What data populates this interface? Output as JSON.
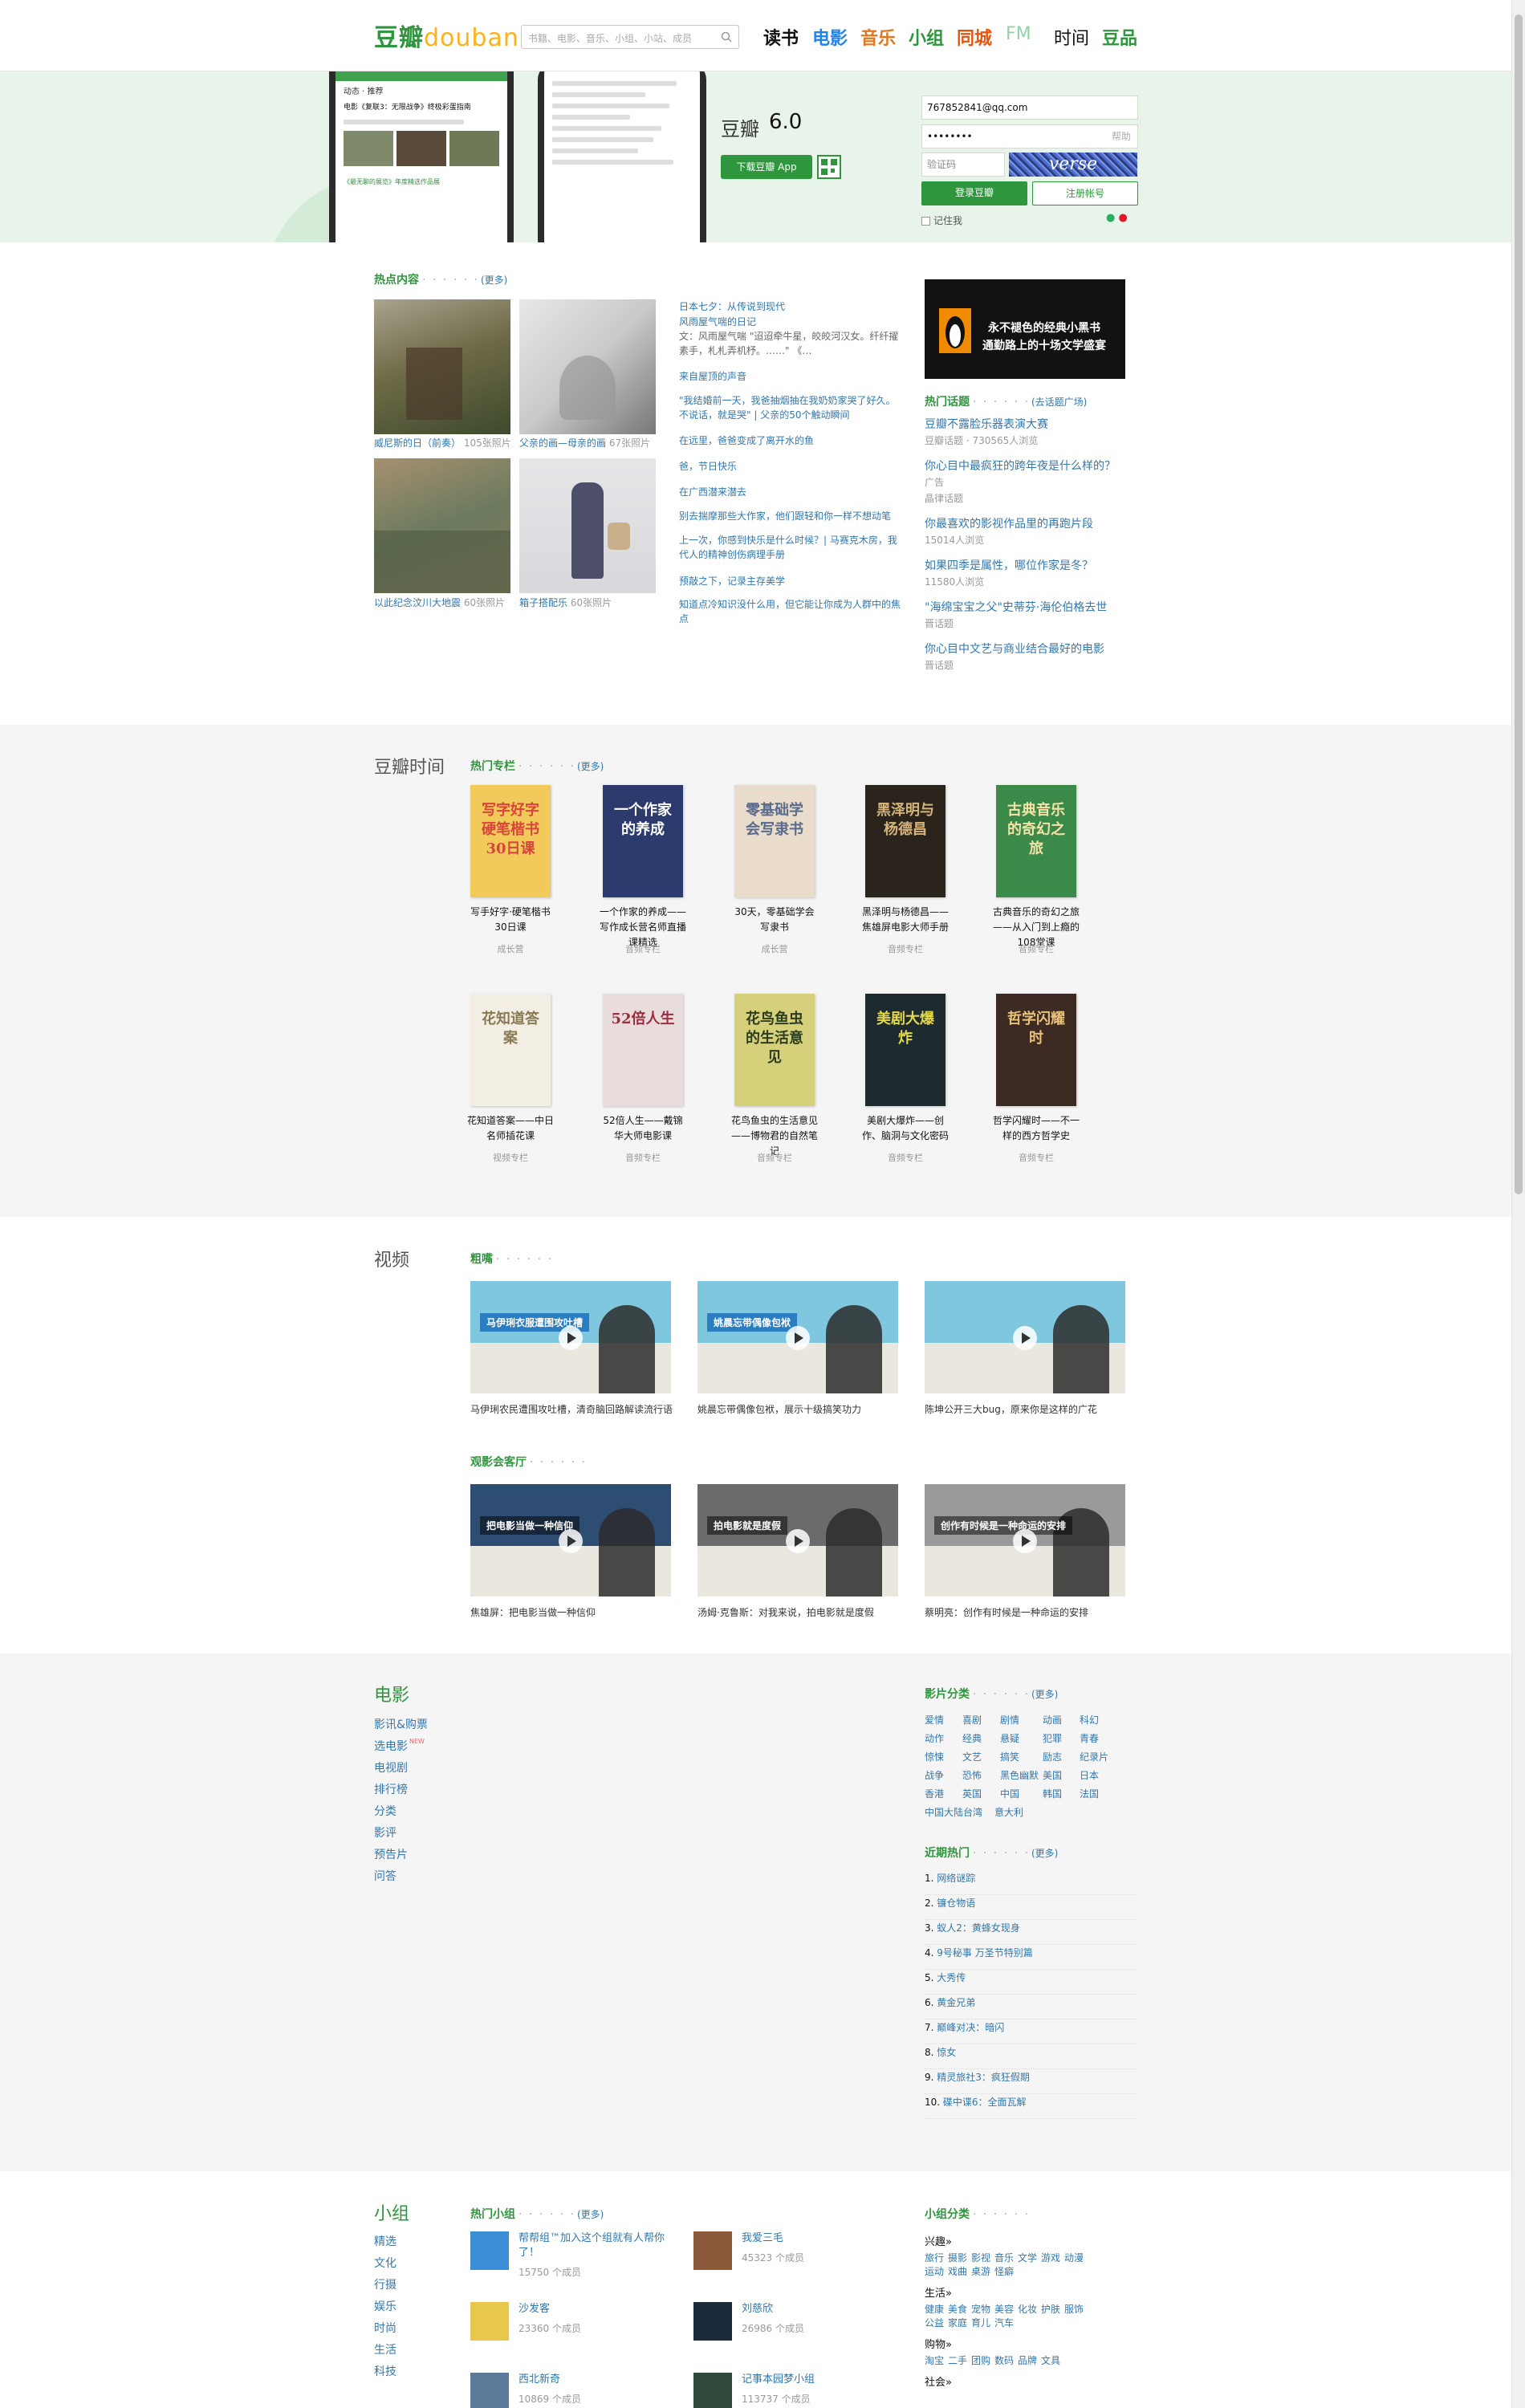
{
  "nav": {
    "logo_cn": "豆瓣",
    "logo_en": "douban",
    "search_placeholder": "书籍、电影、音乐、小组、小站、成员",
    "items": [
      "读书",
      "电影",
      "音乐",
      "小组",
      "同城",
      "FM",
      "时间",
      "豆品"
    ],
    "colors": [
      "#111111",
      "#2384e6",
      "#e3771f",
      "#2e963d",
      "#e6550d",
      "#93d1a8",
      "#111111",
      "#2e963d"
    ]
  },
  "hero": {
    "app_name": "豆瓣",
    "app_version": "6.0",
    "download_label": "下载豆瓣 App",
    "login": {
      "email_value": "767852841@qq.com",
      "password_value": "••••••••",
      "password_help": "帮助",
      "captcha_placeholder": "验证码",
      "captcha_text": "verse",
      "login_label": "登录豆瓣",
      "register_label": "注册帐号",
      "remember_label": "记住我"
    },
    "phone_texts": [
      "动态",
      "推荐",
      "电影《复联3：无限战争》终极彩蛋指南",
      "《最无聊的展览》年度精选作品展"
    ]
  },
  "hot": {
    "heading": "热点内容",
    "more": "(更多)",
    "photos": [
      {
        "title": "威尼斯的日（前奏）",
        "count": "105张照片",
        "colors": [
          "#6f6a48",
          "#a8a48e",
          "#3d4a2c"
        ]
      },
      {
        "title": "父亲的画—母亲的画",
        "count": "67张照片",
        "colors": [
          "#c9c9c9",
          "#777777",
          "#e8e8e8"
        ]
      },
      {
        "title": "以此纪念汶川大地震",
        "count": "60张照片",
        "colors": [
          "#6c7a5e",
          "#8a7a5c",
          "#a69070"
        ]
      },
      {
        "title": "箱子搭配乐",
        "count": "60张照片",
        "colors": [
          "#e6e6e9",
          "#4d4f6a",
          "#c9b08a"
        ]
      }
    ],
    "links": [
      {
        "text": "日本七夕：从传说到现代",
        "type": "link"
      },
      {
        "text": "风雨屋气喘的日记",
        "type": "link"
      },
      {
        "text": "文：风雨屋气喘 \"迢迢牵牛星，皎皎河汉女。纤纤擢素手，札札弄机杼。……\" 《…",
        "type": "sub"
      },
      {
        "text": "来自屋顶的声音",
        "type": "link"
      },
      {
        "text": "\"我结婚前一天，我爸抽烟抽在我奶奶家哭了好久。不说话，就是哭\" | 父亲的50个触动瞬间",
        "type": "link"
      },
      {
        "text": "在远里，爸爸变成了离开水的鱼",
        "type": "link"
      },
      {
        "text": "爸，节日快乐",
        "type": "link"
      },
      {
        "text": "在广西潜来潜去",
        "type": "link"
      },
      {
        "text": "别去揣摩那些大作家，他们跟轻和你一样不想动笔",
        "type": "link"
      },
      {
        "text": "上一次，你感到快乐是什么时候？| 马赛克木房，我代人的精神创伤病理手册",
        "type": "link"
      },
      {
        "text": "预敲之下，记录主存美学",
        "type": "link"
      },
      {
        "text": "知道点冷知识没什么用，但它能让你成为人群中的焦点",
        "type": "link"
      }
    ],
    "ad": {
      "line1": "永不褪色的经典小黑书",
      "line2": "通勤路上的十场文学盛宴"
    },
    "topics_heading": "热门话题",
    "topics_more": "(去话题广场)",
    "topics": [
      {
        "title": "豆瓣不露脸乐器表演大赛",
        "sub": "豆瓣话题 · 730565人浏览"
      },
      {
        "title": "你心目中最疯狂的跨年夜是什么样的？",
        "sub": "广告"
      },
      {
        "title": "",
        "sub": "晶律话题"
      },
      {
        "title": "你最喜欢的影视作品里的再跑片段",
        "sub": "15014人浏览"
      },
      {
        "title": "如果四季是属性，哪位作家是冬？",
        "sub": "11580人浏览"
      },
      {
        "title": "\"海绵宝宝之父\"史蒂芬·海伦伯格去世",
        "sub": "晋话题"
      },
      {
        "title": "你心目中文艺与商业结合最好的电影",
        "sub": "晋话题"
      }
    ]
  },
  "time": {
    "section": "豆瓣时间",
    "heading": "热门专栏",
    "more": "(更多)",
    "books": [
      {
        "cover": "写字好字 硬笔楷书 30日课",
        "title": "写手好字·硬笔楷书30日课",
        "sub": "成长营",
        "bg": "#f2c95b",
        "fg": "#d9453b"
      },
      {
        "cover": "一个作家的养成",
        "title": "一个作家的养成——写作成长营名师直播课精选",
        "sub": "音频专栏",
        "bg": "#2d3a6e",
        "fg": "#ffffff"
      },
      {
        "cover": "零基础学会写隶书",
        "title": "30天，零基础学会写隶书",
        "sub": "成长营",
        "bg": "#e9dccb",
        "fg": "#5a6b8c"
      },
      {
        "cover": "黑泽明与杨德昌",
        "title": "黑泽明与杨德昌——焦雄屏电影大师手册",
        "sub": "音频专栏",
        "bg": "#2a241c",
        "fg": "#d6b47a"
      },
      {
        "cover": "古典音乐的奇幻之旅",
        "title": "古典音乐的奇幻之旅——从入门到上瘾的108堂课",
        "sub": "音频专栏",
        "bg": "#3c8a4a",
        "fg": "#f3e3a6"
      },
      {
        "cover": "花知道答案",
        "title": "花知道答案——中日名师插花课",
        "sub": "视频专栏",
        "bg": "#f3eee4",
        "fg": "#8a7a54"
      },
      {
        "cover": "52倍人生",
        "title": "52倍人生——戴锦华大师电影课",
        "sub": "音频专栏",
        "bg": "#e8dcdc",
        "fg": "#9c2f3f"
      },
      {
        "cover": "花鸟鱼虫的生活意见",
        "title": "花鸟鱼虫的生活意见——博物君的自然笔记",
        "sub": "音频专栏",
        "bg": "#d7d07a",
        "fg": "#2c3e1f"
      },
      {
        "cover": "美剧大爆炸",
        "title": "美剧大爆炸——创作、脑洞与文化密码",
        "sub": "音频专栏",
        "bg": "#1d2a2e",
        "fg": "#e4d94a"
      },
      {
        "cover": "哲学闪耀时",
        "title": "哲学闪耀时——不一样的西方哲学史",
        "sub": "音频专栏",
        "bg": "#3d2a22",
        "fg": "#e8c27a"
      }
    ]
  },
  "video": {
    "section": "视频",
    "heading1": "粗嘴",
    "heading2": "观影会客厅",
    "row1": [
      {
        "caption": "马伊琍农民遭围攻吐槽，清奇脑回路解读流行语",
        "overlay": "马伊琍衣服遭围攻吐槽",
        "bg": "#7fc6df",
        "band": "#2b7dc1"
      },
      {
        "caption": "姚晨忘带偶像包袱，展示十级搞笑功力",
        "overlay": "姚晨忘带偶像包袱",
        "bg": "#7fc6df",
        "band": "#2b7dc1"
      },
      {
        "caption": "陈坤公开三大bug，原来你是这样的广花",
        "overlay": "",
        "bg": "#7fc6df",
        "band": "#2b7dc1"
      }
    ],
    "row2": [
      {
        "caption": "焦雄屏：把电影当做一种信仰",
        "overlay": "把电影当做一种信仰",
        "bg": "#2e4d73",
        "band": ""
      },
      {
        "caption": "汤姆·克鲁斯：对我来说，拍电影就是度假",
        "overlay": "拍电影就是度假",
        "bg": "#6b6b6b",
        "band": ""
      },
      {
        "caption": "蔡明亮：创作有时候是一种命运的安排",
        "overlay": "创作有时候是一种命运的安排",
        "bg": "#9a9a9a",
        "band": ""
      }
    ]
  },
  "movie": {
    "section": "电影",
    "nav": [
      "影讯&购票",
      "选电影",
      "电视剧",
      "排行榜",
      "分类",
      "影评",
      "预告片",
      "问答"
    ],
    "new_badge": "NEW",
    "genre_heading": "影片分类",
    "genre_more": "(更多)",
    "genres": [
      [
        "爱情",
        "喜剧",
        "剧情",
        "动画",
        "科幻"
      ],
      [
        "动作",
        "经典",
        "悬疑",
        "犯罪",
        "青春"
      ],
      [
        "惊悚",
        "文艺",
        "搞笑",
        "励志",
        "纪录片"
      ],
      [
        "战争",
        "恐怖",
        "黑色幽默",
        "美国",
        "日本"
      ],
      [
        "香港",
        "英国",
        "中国",
        "韩国",
        "法国"
      ],
      [
        "中国大陆台湾",
        "意大利"
      ]
    ],
    "recent_heading": "近期热门",
    "recent_more": "(更多)",
    "recent": [
      "网络谜踪",
      "镰仓物语",
      "蚁人2：黄蜂女现身",
      "9号秘事 万圣节特别篇",
      "大秀传",
      "黄金兄弟",
      "巅峰对决：暗闪",
      "惊女",
      "精灵旅社3：疯狂假期",
      "碟中谍6：全面瓦解"
    ]
  },
  "group": {
    "section": "小组",
    "nav": [
      "精选",
      "文化",
      "行摄",
      "娱乐",
      "时尚",
      "生活",
      "科技"
    ],
    "heading": "热门小组",
    "more": "(更多)",
    "items": [
      {
        "name": "帮帮组™加入这个组就有人帮你了！",
        "members": "15750 个成员",
        "color": "#3b8dd6"
      },
      {
        "name": "我爱三毛",
        "members": "45323 个成员",
        "color": "#8a5a3a"
      },
      {
        "name": "沙发客",
        "members": "23360 个成员",
        "color": "#e8c84a"
      },
      {
        "name": "刘慈欣",
        "members": "26986 个成员",
        "color": "#1b2a3a"
      },
      {
        "name": "西北新奇",
        "members": "10869 个成员",
        "color": "#5e7a9a"
      },
      {
        "name": "记事本园梦小组",
        "members": "113737 个成员",
        "color": "#2f4a3a"
      }
    ],
    "cat_heading": "小组分类",
    "categories": [
      {
        "name": "兴趣»",
        "items": [
          [
            "旅行",
            "摄影",
            "影视",
            "音乐",
            "文学",
            "游戏",
            "动漫"
          ],
          [
            "运动",
            "戏曲",
            "桌游",
            "怪癖"
          ]
        ]
      },
      {
        "name": "生活»",
        "items": [
          [
            "健康",
            "美食",
            "宠物",
            "美容",
            "化妆",
            "护肤",
            "服饰"
          ],
          [
            "公益",
            "家庭",
            "育儿",
            "汽车"
          ]
        ]
      },
      {
        "name": "购物»",
        "items": [
          [
            "淘宝",
            "二手",
            "团购",
            "数码",
            "品牌",
            "文具"
          ]
        ]
      },
      {
        "name": "社会»",
        "items": []
      }
    ]
  }
}
